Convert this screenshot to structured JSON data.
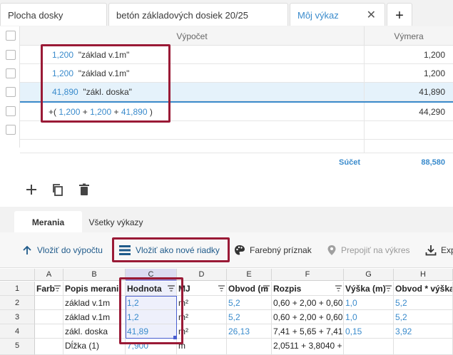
{
  "tabs": [
    {
      "label": "Plocha dosky"
    },
    {
      "label": "betón základových dosiek 20/25"
    },
    {
      "label": "Môj výkaz",
      "active": true
    }
  ],
  "tab_close": "✕",
  "tab_add": "+",
  "grid": {
    "col_calc": "Výpočet",
    "col_vymera": "Výmera",
    "rows": [
      {
        "num": "1,200",
        "text": "\"základ v.1m\"",
        "value": "1,200"
      },
      {
        "num": "1,200",
        "text": "\"základ v.1m\"",
        "value": "1,200"
      },
      {
        "num": "41,890",
        "text": "\"zákl. doska\"",
        "value": "41,890",
        "selected": true
      }
    ],
    "sum_row": {
      "prefix": "+(",
      "n1": "1,200",
      "plus1": "+",
      "n2": "1,200",
      "plus2": "+",
      "n3": "41,890",
      "suffix": ")",
      "value": "44,290"
    },
    "total_label": "Súčet",
    "total_value": "88,580"
  },
  "lower_tabs": {
    "merania": "Merania",
    "vsetky": "Všetky výkazy"
  },
  "ribbon": {
    "vlozit_vypoctu": "Vložiť do výpočtu",
    "vlozit_riadky": "Vložiť ako nové riadky",
    "farebny": "Farebný príznak",
    "prepojit": "Prepojiť na výkres",
    "export": "Exp"
  },
  "sheet": {
    "columns": [
      "A",
      "B",
      "C",
      "D",
      "E",
      "F",
      "G",
      "H"
    ],
    "row_numbers": [
      "1",
      "2",
      "3",
      "4",
      "5"
    ],
    "headers": [
      "Farb",
      "Popis merani",
      "Hodnota",
      "MJ",
      "Obvod (m",
      "Rozpis",
      "Výška (m)",
      "Obvod * výška"
    ],
    "rows": [
      {
        "popis": "základ v.1m",
        "hodnota": "1,2",
        "mj": "m²",
        "obvod": "5,2",
        "rozpis": "0,60 + 2,00 + 0,60",
        "vyska": "1,0",
        "ov": "5,2"
      },
      {
        "popis": "základ v.1m",
        "hodnota": "1,2",
        "mj": "m²",
        "obvod": "5,2",
        "rozpis": "0,60 + 2,00 + 0,60",
        "vyska": "1,0",
        "ov": "5,2"
      },
      {
        "popis": "zákl. doska",
        "hodnota": "41,89",
        "mj": "m²",
        "obvod": "26,13",
        "rozpis": "7,41 + 5,65 + 7,41",
        "vyska": "0,15",
        "ov": "3,92"
      },
      {
        "popis": "Dĺžka (1)",
        "hodnota": "7,900",
        "mj": "m",
        "obvod": "",
        "rozpis": "2,0511 + 3,8040 +",
        "vyska": "",
        "ov": ""
      }
    ]
  },
  "colors": {
    "accent": "#3a8bcc",
    "highlight": "#9a1a36"
  }
}
